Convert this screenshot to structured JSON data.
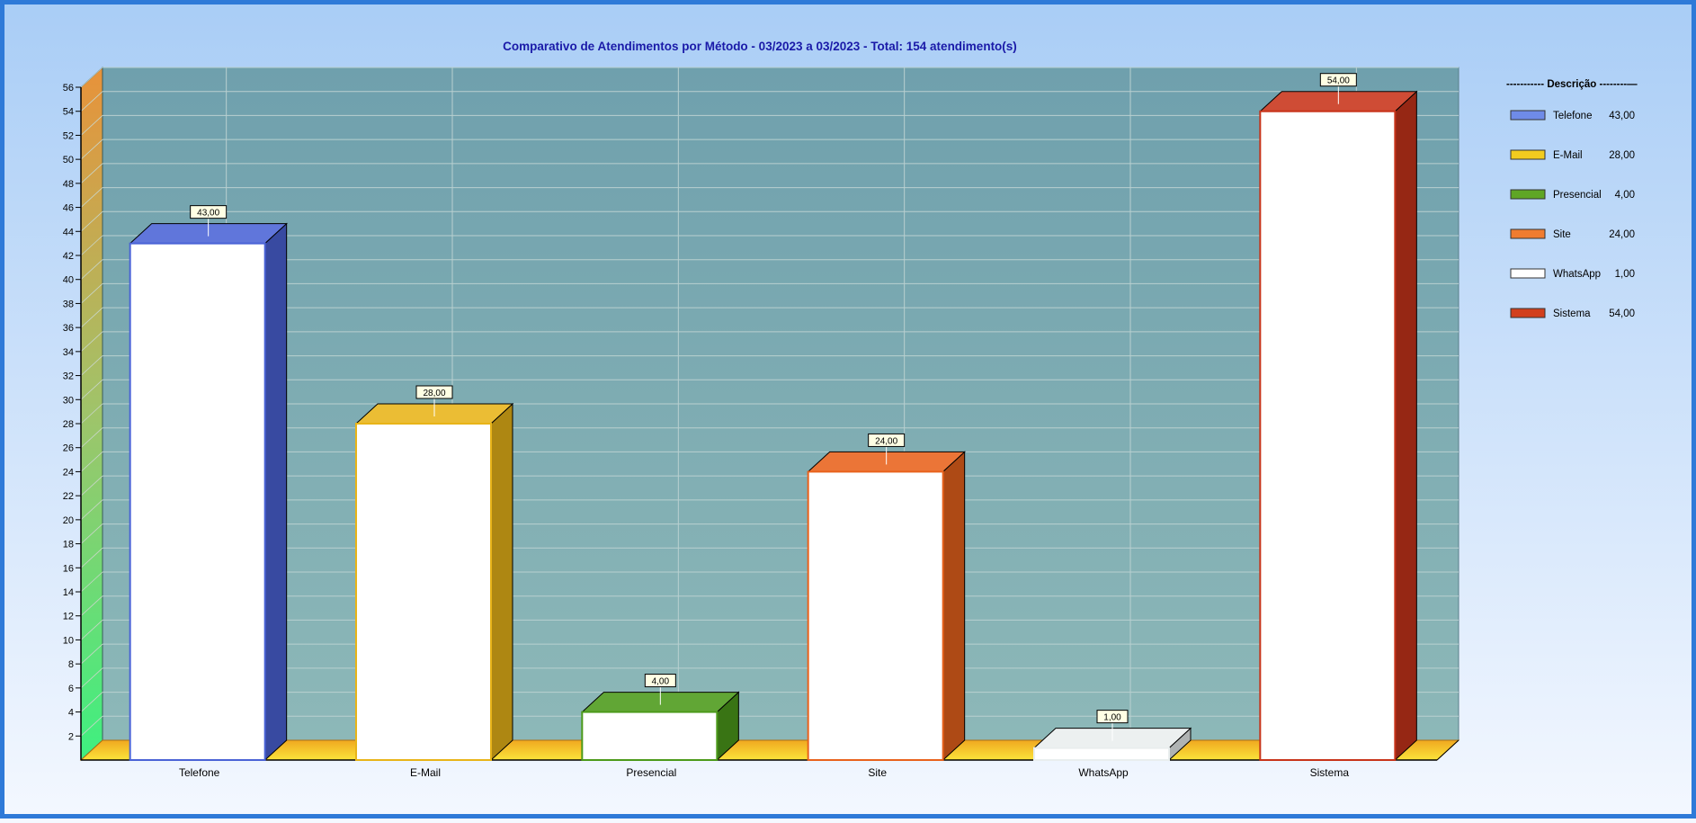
{
  "chart_data": {
    "type": "bar",
    "title": "Comparativo de Atendimentos por Método - 03/2023 a 03/2023 - Total: 154 atendimento(s)",
    "categories": [
      "Telefone",
      "E-Mail",
      "Presencial",
      "Site",
      "WhatsApp",
      "Sistema"
    ],
    "values": [
      43,
      28,
      4,
      24,
      1,
      54
    ],
    "data_labels": [
      "43,00",
      "28,00",
      "4,00",
      "24,00",
      "1,00",
      "54,00"
    ],
    "colors": [
      "#4a63d6",
      "#e8b418",
      "#4c9a1a",
      "#e8621c",
      "#e9eeee",
      "#c8341a"
    ],
    "ylim": [
      0,
      56
    ],
    "yticks": [
      2,
      4,
      6,
      8,
      10,
      12,
      14,
      16,
      18,
      20,
      22,
      24,
      26,
      28,
      30,
      32,
      34,
      36,
      38,
      40,
      42,
      44,
      46,
      48,
      50,
      52,
      54,
      56
    ],
    "grid": true,
    "three_d": true,
    "legend": {
      "position": "right",
      "title": "----------- Descrição --------—",
      "entries": [
        {
          "name": "Telefone",
          "value": "43,00",
          "color": "#6f8be8"
        },
        {
          "name": "E-Mail",
          "value": "28,00",
          "color": "#f2cb1e"
        },
        {
          "name": "Presencial",
          "value": "4,00",
          "color": "#5fa625"
        },
        {
          "name": "Site",
          "value": "24,00",
          "color": "#f07c30"
        },
        {
          "name": "WhatsApp",
          "value": "1,00",
          "color": "#ffffff"
        },
        {
          "name": "Sistema",
          "value": "54,00",
          "color": "#d2401e"
        }
      ]
    }
  }
}
